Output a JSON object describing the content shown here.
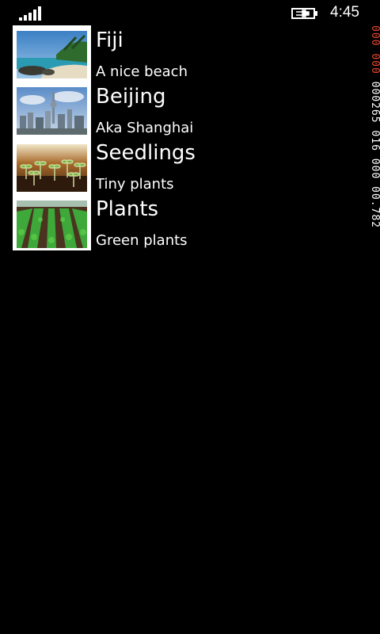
{
  "status_bar": {
    "time": "4:45",
    "signal_icon": "signal-strength-icon",
    "battery_icon": "battery-charging-icon"
  },
  "items": [
    {
      "title": "Fiji",
      "subtitle": "A nice beach",
      "image": "beach-photo"
    },
    {
      "title": "Beijing",
      "subtitle": "Aka Shanghai",
      "image": "city-skyline-photo"
    },
    {
      "title": "Seedlings",
      "subtitle": "Tiny plants",
      "image": "seedlings-photo"
    },
    {
      "title": "Plants",
      "subtitle": "Green plants",
      "image": "field-rows-photo"
    }
  ],
  "frame_counter": {
    "segments": [
      {
        "text": "000",
        "color": "#e8442e"
      },
      {
        "text": "000",
        "color": "#e8442e"
      },
      {
        "text": "000265",
        "color": "#ffffff"
      },
      {
        "text": "016",
        "color": "#ffffff"
      },
      {
        "text": "000",
        "color": "#ffffff"
      },
      {
        "text": "00.782",
        "color": "#ffffff"
      }
    ]
  }
}
